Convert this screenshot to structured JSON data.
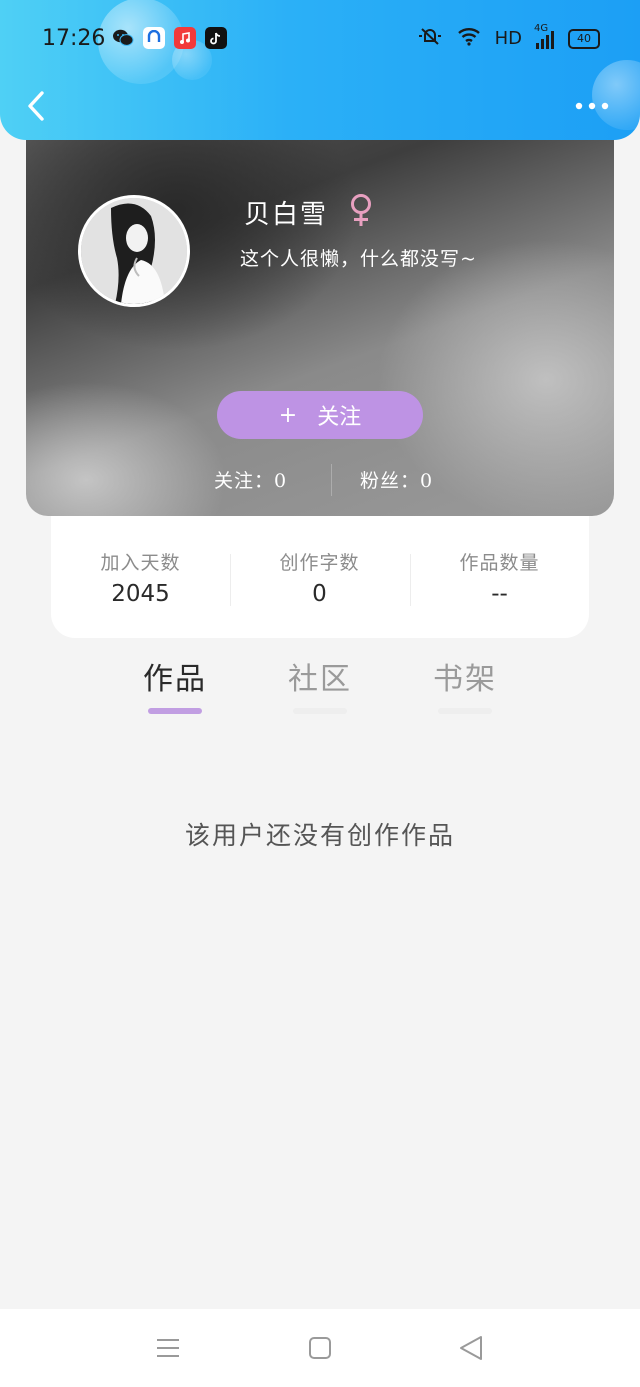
{
  "status_bar": {
    "time": "17:26",
    "network": "HD",
    "signal_label": "4G",
    "battery": "40",
    "apps": [
      "wechat-icon",
      "security-app-icon",
      "music-app-icon",
      "tiktok-icon"
    ]
  },
  "header": {
    "back_icon": "chevron-left-icon",
    "more_icon": "more-dots-icon"
  },
  "profile": {
    "name": "贝白雪",
    "gender_symbol": "♀",
    "bio": "这个人很懒，什么都没写~",
    "follow_plus": "+",
    "follow_label": "关注",
    "following_text": "关注：0",
    "fans_text": "粉丝：0"
  },
  "stats": [
    {
      "label": "加入天数",
      "value": "2045"
    },
    {
      "label": "创作字数",
      "value": "0"
    },
    {
      "label": "作品数量",
      "value": "--"
    }
  ],
  "tabs": [
    {
      "label": "作品",
      "active": true
    },
    {
      "label": "社区",
      "active": false
    },
    {
      "label": "书架",
      "active": false
    }
  ],
  "empty_message": "该用户还没有创作作品",
  "colors": {
    "header_blue": "#2bb0f7",
    "accent_purple": "#be93e4",
    "gender_pink": "#e8a0c0",
    "background": "#f4f4f4"
  }
}
